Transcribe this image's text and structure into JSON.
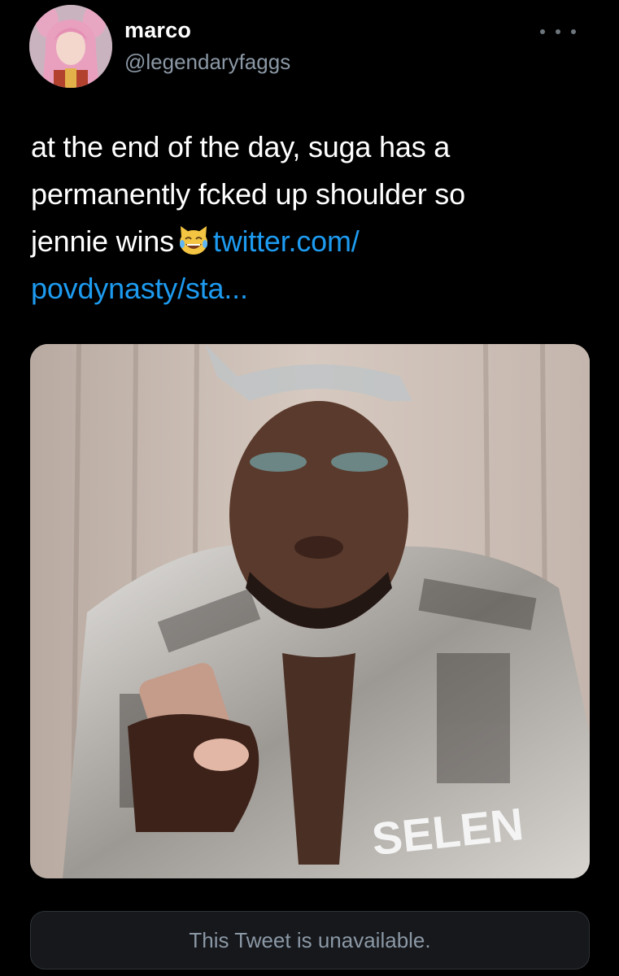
{
  "tweet": {
    "author": {
      "display_name": "marco",
      "handle": "@legendaryfaggs",
      "avatar_icon": "profile-avatar"
    },
    "more_icon": "more-horizontal-icon",
    "text": {
      "line1": "at the end of the day, suga has a",
      "line2": "permanently fcked up shoulder so",
      "line3_prefix": "jennie wins",
      "emoji": "tears-of-joy-cat-emoji",
      "link_part1": "twitter.com/",
      "link_part2": "povdynasty/sta..."
    },
    "media": {
      "type": "photo",
      "visible_text": "SELEN"
    },
    "quoted": {
      "message": "This Tweet is unavailable."
    }
  },
  "colors": {
    "background": "#000000",
    "text": "#ffffff",
    "secondary": "#8b98a5",
    "link": "#1d9bf0",
    "card_bg": "#16181c",
    "card_border": "#2f3336"
  }
}
